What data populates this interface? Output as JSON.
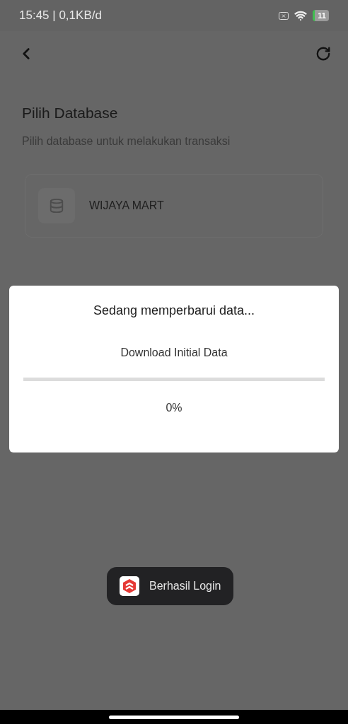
{
  "status_bar": {
    "time_speed": "15:45 | 0,1KB/d",
    "battery": "11"
  },
  "page": {
    "title": "Pilih Database",
    "subtitle": "Pilih database untuk melakukan transaksi",
    "databases": [
      {
        "name": "WIJAYA MART"
      }
    ]
  },
  "dialog": {
    "title": "Sedang memperbarui data...",
    "step": "Download Initial Data",
    "progress": {
      "level": 0
    },
    "percent": "0%"
  },
  "toast": {
    "message": "Berhasil Login"
  }
}
